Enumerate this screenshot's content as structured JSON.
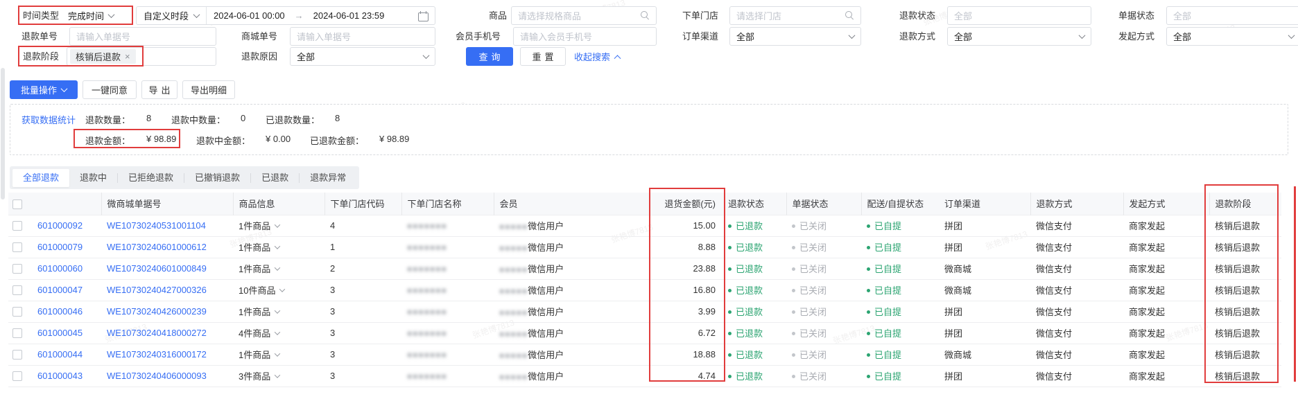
{
  "watermark_text": "张艳博7813",
  "colors": {
    "accent": "#366ef4",
    "status_green": "#2ba471",
    "status_grey": "#aaadb3",
    "annotation_red": "#e13c3c"
  },
  "filters": {
    "time_type": {
      "label": "时间类型",
      "value": "完成时间"
    },
    "period": {
      "value": "自定义时段",
      "start": "2024-06-01 00:00",
      "arrow": "→",
      "end": "2024-06-01 23:59"
    },
    "product": {
      "label": "商品",
      "placeholder": "请选择规格商品"
    },
    "order_store": {
      "label": "下单门店",
      "placeholder": "请选择门店"
    },
    "refund_status": {
      "label": "退款状态",
      "placeholder": "全部"
    },
    "doc_status": {
      "label": "单据状态",
      "placeholder": "全部"
    },
    "refund_no": {
      "label": "退款单号",
      "placeholder": "请输入单据号"
    },
    "mall_no": {
      "label": "商城单号",
      "placeholder": "请输入单据号"
    },
    "member_phone": {
      "label": "会员手机号",
      "placeholder": "请输入会员手机号"
    },
    "order_channel": {
      "label": "订单渠道",
      "value": "全部"
    },
    "refund_method": {
      "label": "退款方式",
      "value": "全部"
    },
    "initiate_method": {
      "label": "发起方式",
      "value": "全部"
    },
    "refund_stage": {
      "label": "退款阶段",
      "tag": "核销后退款",
      "tag_close": "×"
    },
    "refund_reason": {
      "label": "退款原因",
      "value": "全部"
    },
    "search_btn": "查询",
    "reset_btn": "重置",
    "collapse_link": "收起搜索"
  },
  "toolbar": {
    "batch": "批量操作",
    "one_click_agree": "一键同意",
    "export": "导出",
    "export_detail": "导出明细"
  },
  "stats": {
    "link": "获取数据统计",
    "refund_count_label": "退款数量：",
    "refund_count": "8",
    "refunding_count_label": "退款中数量：",
    "refunding_count": "0",
    "refunded_count_label": "已退款数量：",
    "refunded_count": "8",
    "refund_amount_label": "退款金额：",
    "refund_amount": "¥ 98.89",
    "refunding_amount_label": "退款中金额：",
    "refunding_amount": "¥ 0.00",
    "refunded_amount_label": "已退款金额：",
    "refunded_amount": "¥ 98.89"
  },
  "tabs": [
    "全部退款",
    "退款中",
    "已拒绝退款",
    "已撤销退款",
    "已退款",
    "退款异常"
  ],
  "table": {
    "headers": {
      "we_no": "微商城单据号",
      "items": "商品信息",
      "store_code": "下单门店代码",
      "store_name": "下单门店名称",
      "member": "会员",
      "amount": "退货金额(元)",
      "refund_status": "退款状态",
      "doc_status": "单据状态",
      "delivery_status": "配送/自提状态",
      "channel": "订单渠道",
      "method": "退款方式",
      "initiator": "发起方式",
      "stage": "退款阶段"
    },
    "rows": [
      {
        "id": "601000092",
        "we_no": "WE10730240531001104",
        "items": "1件商品",
        "store_code": "4",
        "store_masked": "●●●●●●●",
        "member_masked": "●●●●●",
        "member_suffix": "微信用户",
        "amount": "15.00",
        "refund_status": "已退款",
        "doc_status": "已关闭",
        "delivery_status": "已自提",
        "channel": "拼团",
        "method": "微信支付",
        "initiator": "商家发起",
        "stage": "核销后退款"
      },
      {
        "id": "601000079",
        "we_no": "WE10730240601000612",
        "items": "1件商品",
        "store_code": "1",
        "store_masked": "●●●●●●●",
        "member_masked": "●●●●●",
        "member_suffix": "微信用户",
        "amount": "8.88",
        "refund_status": "已退款",
        "doc_status": "已关闭",
        "delivery_status": "已自提",
        "channel": "拼团",
        "method": "微信支付",
        "initiator": "商家发起",
        "stage": "核销后退款"
      },
      {
        "id": "601000060",
        "we_no": "WE10730240601000849",
        "items": "1件商品",
        "store_code": "2",
        "store_masked": "●●●●●●●",
        "member_masked": "●●●●●",
        "member_suffix": "微信用户",
        "amount": "23.88",
        "refund_status": "已退款",
        "doc_status": "已关闭",
        "delivery_status": "已自提",
        "channel": "微商城",
        "method": "微信支付",
        "initiator": "商家发起",
        "stage": "核销后退款"
      },
      {
        "id": "601000047",
        "we_no": "WE10730240427000326",
        "items": "10件商品",
        "store_code": "3",
        "store_masked": "●●●●●●●",
        "member_masked": "●●●●●",
        "member_suffix": "微信用户",
        "amount": "16.80",
        "refund_status": "已退款",
        "doc_status": "已关闭",
        "delivery_status": "已自提",
        "channel": "微商城",
        "method": "微信支付",
        "initiator": "商家发起",
        "stage": "核销后退款"
      },
      {
        "id": "601000046",
        "we_no": "WE10730240426000239",
        "items": "1件商品",
        "store_code": "3",
        "store_masked": "●●●●●●●",
        "member_masked": "●●●●●",
        "member_suffix": "微信用户",
        "amount": "3.99",
        "refund_status": "已退款",
        "doc_status": "已关闭",
        "delivery_status": "已自提",
        "channel": "拼团",
        "method": "微信支付",
        "initiator": "商家发起",
        "stage": "核销后退款"
      },
      {
        "id": "601000045",
        "we_no": "WE10730240418000272",
        "items": "4件商品",
        "store_code": "3",
        "store_masked": "●●●●●●●",
        "member_masked": "●●●●●",
        "member_suffix": "微信用户",
        "amount": "6.72",
        "refund_status": "已退款",
        "doc_status": "已关闭",
        "delivery_status": "已自提",
        "channel": "拼团",
        "method": "微信支付",
        "initiator": "商家发起",
        "stage": "核销后退款"
      },
      {
        "id": "601000044",
        "we_no": "WE10730240316000172",
        "items": "1件商品",
        "store_code": "3",
        "store_masked": "●●●●●●●",
        "member_masked": "●●●●●",
        "member_suffix": "微信用户",
        "amount": "18.88",
        "refund_status": "已退款",
        "doc_status": "已关闭",
        "delivery_status": "已自提",
        "channel": "微商城",
        "method": "微信支付",
        "initiator": "商家发起",
        "stage": "核销后退款"
      },
      {
        "id": "601000043",
        "we_no": "WE10730240406000093",
        "items": "3件商品",
        "store_code": "3",
        "store_masked": "●●●●●●●",
        "member_masked": "●●●●●",
        "member_suffix": "微信用户",
        "amount": "4.74",
        "refund_status": "已退款",
        "doc_status": "已关闭",
        "delivery_status": "已自提",
        "channel": "拼团",
        "method": "微信支付",
        "initiator": "商家发起",
        "stage": "核销后退款"
      }
    ]
  }
}
